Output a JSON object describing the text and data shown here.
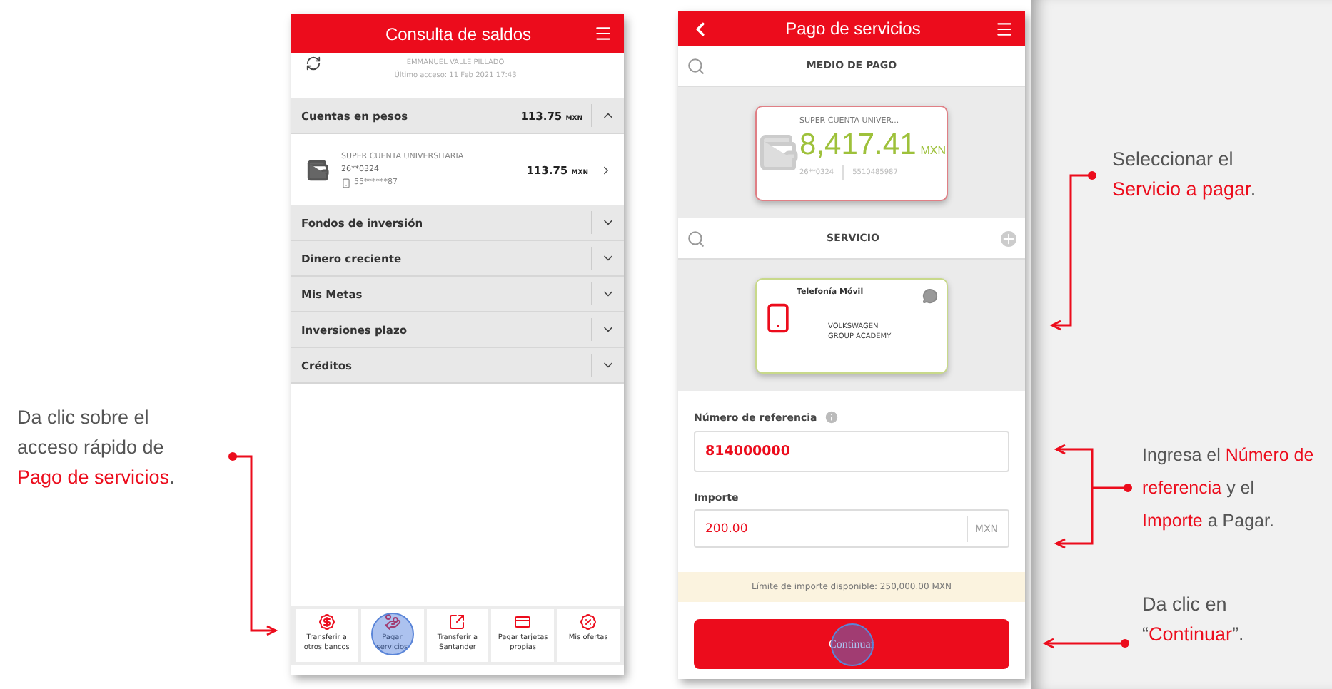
{
  "annotations": [
    {
      "text": "Da clic sobre el\nacceso rápido de\n**Pago de servicios**."
    },
    {
      "text": "Seleccionar el\n**Servicio a pagar**."
    },
    {
      "text": "Ingresa el **Número de**\n**referencia** y el\n**Importe** a Pagar."
    },
    {
      "text": "Da clic en\n“**Continuar**”."
    }
  ],
  "balances_screen": {
    "title": "Consulta de saldos",
    "user_name": "EMMANUEL VALLE PILLADO",
    "last_access": "Último acceso: 11 Feb 2021 17:43",
    "sections": [
      {
        "label": "Cuentas en pesos",
        "amount": "113.75",
        "currency": "MXN",
        "expanded": true,
        "accounts": [
          {
            "name": "SUPER CUENTA UNIVERSITARIA",
            "number": "26**0324",
            "phone": "55******87",
            "amount": "113.75",
            "currency": "MXN"
          }
        ]
      },
      {
        "label": "Fondos de inversión",
        "expanded": false
      },
      {
        "label": "Dinero creciente",
        "expanded": false
      },
      {
        "label": "Mis Metas",
        "expanded": false
      },
      {
        "label": "Inversiones plazo",
        "expanded": false
      },
      {
        "label": "Créditos",
        "expanded": false
      }
    ],
    "quick_actions": [
      {
        "kind": "transfer-other",
        "label": "Transferir a\notros bancos",
        "tapped": false
      },
      {
        "kind": "pay-services",
        "label": "Pagar\nservicios",
        "tapped": true
      },
      {
        "kind": "transfer-own",
        "label": "Transferir a\nSantander",
        "tapped": false
      },
      {
        "kind": "pay-cards",
        "label": "Pagar tarjetas\npropias",
        "tapped": false
      },
      {
        "kind": "offers",
        "label": "Mis ofertas",
        "tapped": false
      }
    ]
  },
  "payment_screen": {
    "title": "Pago de servicios",
    "payment_method": {
      "header": "MEDIO DE PAGO",
      "card": {
        "name": "SUPER CUENTA UNIVER...",
        "amount": "8,417.41",
        "currency": "MXN",
        "number": "26**0324",
        "phone": "5510485987"
      }
    },
    "service": {
      "header": "SERVICIO",
      "card": {
        "category": "Telefonía Móvil",
        "name": "VOLKSWAGEN\nGROUP ACADEMY"
      }
    },
    "reference": {
      "label": "Número de referencia",
      "value": "814000000"
    },
    "amount": {
      "label": "Importe",
      "value": "200.00",
      "currency": "MXN"
    },
    "limit": "Límite de importe disponible:  250,000.00 MXN",
    "button": {
      "label": "Continuar",
      "tapped": true
    }
  }
}
